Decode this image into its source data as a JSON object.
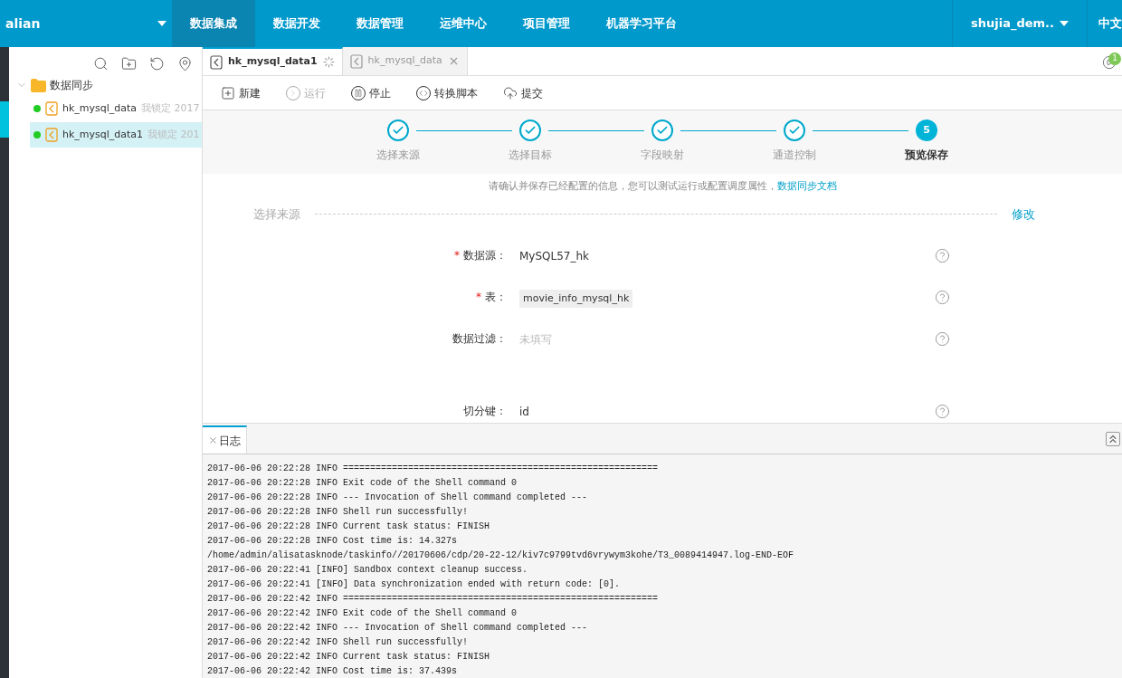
{
  "header": {
    "workspace": "alian",
    "nav": [
      {
        "label": "数据集成",
        "selected": true
      },
      {
        "label": "数据开发",
        "selected": false
      },
      {
        "label": "数据管理",
        "selected": false
      },
      {
        "label": "运维中心",
        "selected": false
      },
      {
        "label": "项目管理",
        "selected": false
      },
      {
        "label": "机器学习平台",
        "selected": false
      }
    ],
    "user": "shujia_dem..",
    "language": "中文"
  },
  "sidebar": {
    "tree": [
      {
        "label": "数据同步",
        "expanded": true,
        "children": [
          {
            "name": "hk_mysql_data",
            "lock": "我锁定 2017",
            "online": true,
            "selected": false
          },
          {
            "name": "hk_mysql_data1",
            "lock": "我锁定 201",
            "online": true,
            "selected": true
          }
        ]
      }
    ]
  },
  "tabs": [
    {
      "label": "hk_mysql_data1",
      "selected": true,
      "loading": true
    },
    {
      "label": "hk_mysql_data",
      "selected": false,
      "loading": false
    }
  ],
  "notification_count": "1",
  "toolbar": [
    {
      "kind": "new",
      "label": "新建",
      "disabled": false
    },
    {
      "kind": "run",
      "label": "运行",
      "disabled": true
    },
    {
      "kind": "stop",
      "label": "停止",
      "disabled": false
    },
    {
      "kind": "script",
      "label": "转换脚本",
      "disabled": false
    },
    {
      "kind": "submit",
      "label": "提交",
      "disabled": false
    }
  ],
  "steps": [
    {
      "label": "选择来源",
      "done": true
    },
    {
      "label": "选择目标",
      "done": true
    },
    {
      "label": "字段映射",
      "done": true
    },
    {
      "label": "通道控制",
      "done": true
    },
    {
      "label": "预览保存",
      "done": false,
      "number": "5"
    }
  ],
  "notice": {
    "text": "请确认并保存已经配置的信息，您可以测试运行或配置调度属性，",
    "link": "数据同步文档"
  },
  "section": {
    "title": "选择来源",
    "action": "修改"
  },
  "fields": [
    {
      "marker": "*",
      "label": "数据源：",
      "value": "MySQL57_hk",
      "kind": "text"
    },
    {
      "marker": "*",
      "label": "表：",
      "value": "movie_info_mysql_hk",
      "kind": "tag"
    },
    {
      "label": "数据过滤：",
      "placeholder": "未填写",
      "kind": "empty"
    },
    {
      "label": "切分键：",
      "value": "id",
      "kind": "text"
    }
  ],
  "log": {
    "tab": "日志",
    "lines": [
      "2017-06-06 20:22:28 INFO ==========================================================",
      "2017-06-06 20:22:28 INFO Exit code of the Shell command 0",
      "2017-06-06 20:22:28 INFO --- Invocation of Shell command completed ---",
      "2017-06-06 20:22:28 INFO Shell run successfully!",
      "2017-06-06 20:22:28 INFO Current task status: FINISH",
      "2017-06-06 20:22:28 INFO Cost time is: 14.327s",
      "/home/admin/alisatasknode/taskinfo//20170606/cdp/20-22-12/kiv7c9799tvd6vrywym3kohe/T3_0089414947.log-END-EOF",
      "2017-06-06 20:22:41 [INFO] Sandbox context cleanup success.",
      "2017-06-06 20:22:41 [INFO] Data synchronization ended with return code: [0].",
      "2017-06-06 20:22:42 INFO ==========================================================",
      "2017-06-06 20:22:42 INFO Exit code of the Shell command 0",
      "2017-06-06 20:22:42 INFO --- Invocation of Shell command completed ---",
      "2017-06-06 20:22:42 INFO Shell run successfully!",
      "2017-06-06 20:22:42 INFO Current task status: FINISH",
      "2017-06-06 20:22:42 INFO Cost time is: 37.439s"
    ]
  }
}
